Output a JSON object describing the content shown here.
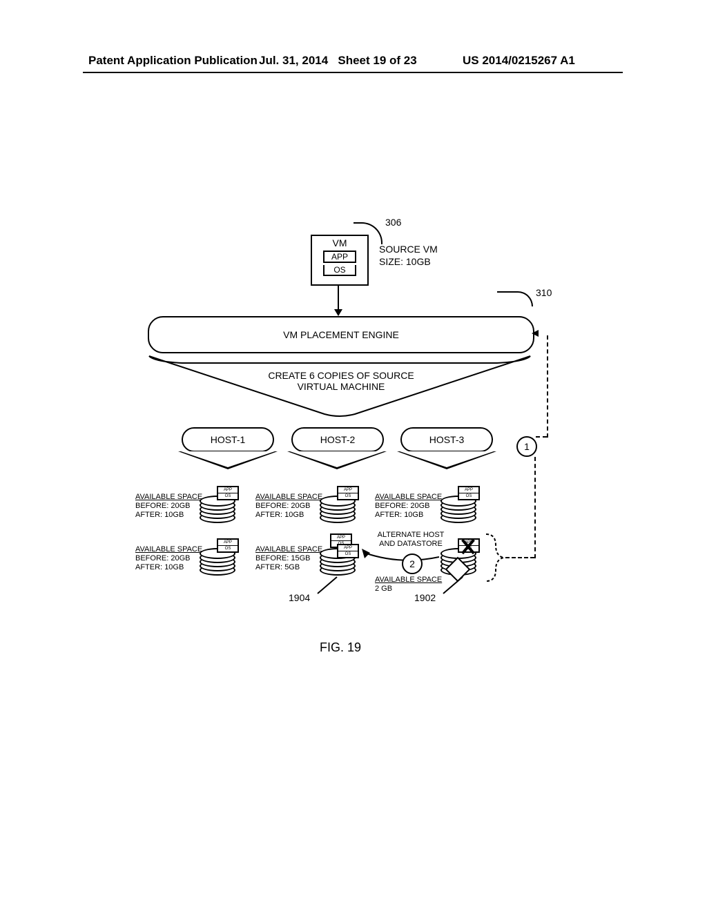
{
  "header": {
    "publication": "Patent Application Publication",
    "date": "Jul. 31, 2014",
    "sheet": "Sheet 19 of 23",
    "docnum": "US 2014/0215267 A1"
  },
  "callouts": {
    "c306": "306",
    "c310": "310",
    "c1904": "1904",
    "c1902": "1902"
  },
  "source_vm": {
    "box_label": "VM",
    "app": "APP",
    "os": "OS",
    "info_line1": "SOURCE VM",
    "info_line2": "SIZE: 10GB"
  },
  "engine": {
    "label": "VM PLACEMENT ENGINE",
    "instruction_line1": "CREATE 6 COPIES OF SOURCE",
    "instruction_line2": "VIRTUAL MACHINE"
  },
  "hosts": [
    {
      "name": "HOST-1"
    },
    {
      "name": "HOST-2"
    },
    {
      "name": "HOST-3"
    }
  ],
  "labels": {
    "available_space": "AVAILABLE SPACE",
    "before": "BEFORE:",
    "after": "AFTER:"
  },
  "tiny": {
    "app": "APP",
    "os": "OS"
  },
  "row1": [
    {
      "before": "20GB",
      "after": "10GB"
    },
    {
      "before": "20GB",
      "after": "10GB"
    },
    {
      "before": "20GB",
      "after": "10GB"
    }
  ],
  "row2": [
    {
      "before": "20GB",
      "after": "10GB"
    },
    {
      "before": "15GB",
      "after": "5GB"
    },
    {
      "only": "2 GB"
    }
  ],
  "alt": {
    "line1": "ALTERNATE HOST",
    "line2": "AND DATASTORE"
  },
  "circles": {
    "one": "1",
    "two": "2"
  },
  "figure": "FIG. 19"
}
